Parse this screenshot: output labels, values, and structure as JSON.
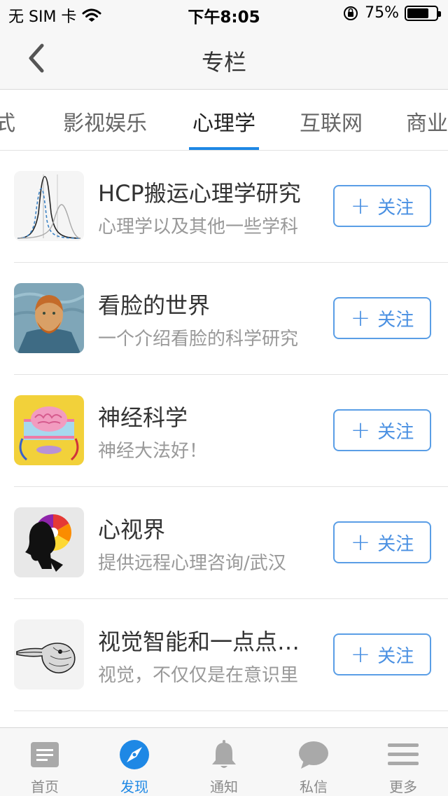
{
  "status_bar": {
    "carrier": "无 SIM 卡",
    "time": "下午8:05",
    "battery": "75%",
    "battery_level": 0.75
  },
  "nav": {
    "title": "专栏"
  },
  "category_tabs": [
    {
      "label": "式"
    },
    {
      "label": "影视娱乐"
    },
    {
      "label": "心理学",
      "active": true
    },
    {
      "label": "互联网"
    },
    {
      "label": "商业"
    }
  ],
  "columns": [
    {
      "title": "HCP搬运心理学研究",
      "desc": "心理学以及其他一些学科",
      "follow": "关注",
      "avatar_icon": "distribution-curves-icon"
    },
    {
      "title": "看脸的世界",
      "desc": "一个介绍看脸的科学研究",
      "follow": "关注",
      "avatar_icon": "van-gogh-portrait-icon"
    },
    {
      "title": "神经科学",
      "desc": "神经大法好！",
      "follow": "关注",
      "avatar_icon": "brain-icon"
    },
    {
      "title": "心视界",
      "desc": "提供远程心理咨询/武汉",
      "follow": "关注",
      "avatar_icon": "color-wheel-head-icon"
    },
    {
      "title": "视觉智能和一点点意识",
      "desc": "视觉，不仅仅是在意识里",
      "follow": "关注",
      "avatar_icon": "duck-rabbit-icon"
    }
  ],
  "tab_bar": [
    {
      "label": "首页",
      "icon": "home-icon"
    },
    {
      "label": "发现",
      "icon": "compass-icon",
      "active": true
    },
    {
      "label": "通知",
      "icon": "bell-icon"
    },
    {
      "label": "私信",
      "icon": "chat-bubble-icon"
    },
    {
      "label": "更多",
      "icon": "menu-icon"
    }
  ],
  "colors": {
    "accent": "#1e88e5",
    "button_border": "#5a9ee6",
    "inactive_icon": "#a9a9a9"
  }
}
